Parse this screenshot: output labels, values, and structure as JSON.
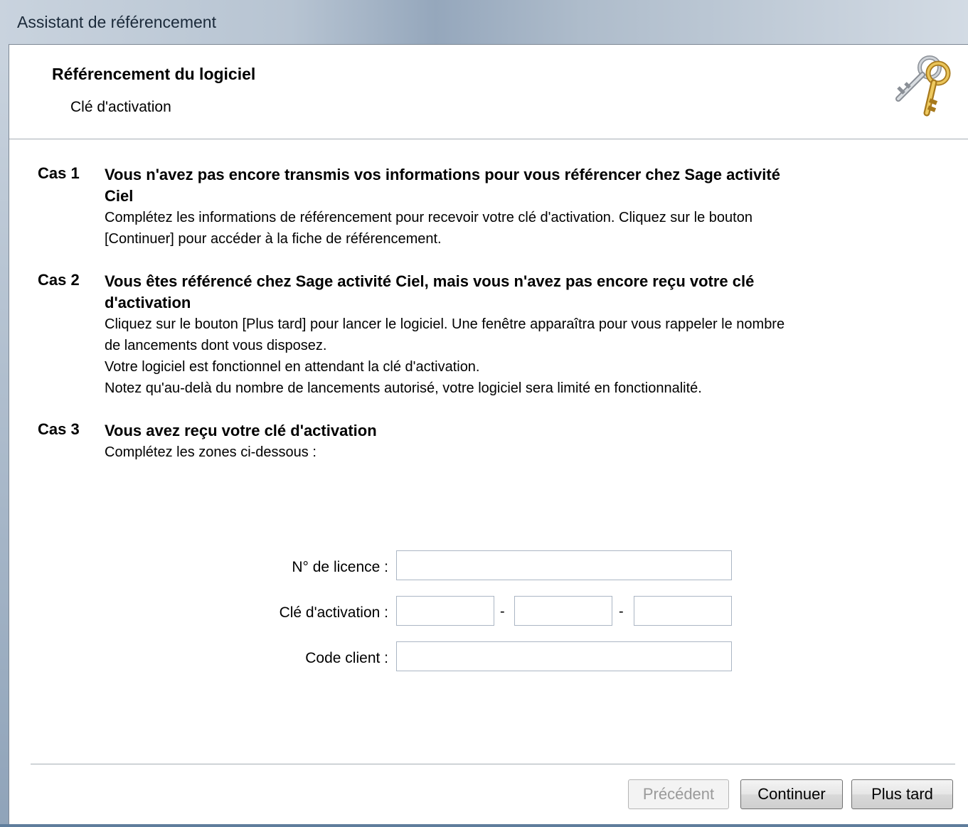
{
  "window": {
    "title": "Assistant de référencement"
  },
  "header": {
    "title": "Référencement du logiciel",
    "subtitle": "Clé d'activation",
    "icon": "keys-icon"
  },
  "cases": [
    {
      "number": "Cas 1",
      "title_lines": [
        "Vous n'avez pas encore transmis vos informations pour vous référencer chez Sage activité",
        "Ciel"
      ],
      "lines": [
        "Complétez les informations de référencement pour recevoir votre clé d'activation. Cliquez sur le bouton",
        "[Continuer] pour accéder à la fiche de référencement."
      ]
    },
    {
      "number": "Cas 2",
      "title_lines": [
        "Vous êtes référencé chez Sage activité Ciel, mais vous n'avez pas encore reçu votre clé",
        "d'activation"
      ],
      "lines": [
        "Cliquez sur le bouton [Plus tard] pour lancer le logiciel. Une fenêtre apparaîtra pour vous rappeler le nombre",
        "de lancements dont vous disposez.",
        "Votre logiciel est fonctionnel en attendant la clé d'activation.",
        "Notez qu'au-delà du nombre de lancements autorisé, votre logiciel sera limité en fonctionnalité."
      ]
    },
    {
      "number": "Cas 3",
      "title_lines": [
        "Vous avez reçu votre clé d'activation"
      ],
      "lines": [
        "Complétez les zones ci-dessous :"
      ]
    }
  ],
  "form": {
    "license_label": "N° de licence :",
    "license_value": "",
    "activation_label": "Clé d'activation :",
    "activation_values": [
      "",
      "",
      ""
    ],
    "separator": "-",
    "client_label": "Code client :",
    "client_value": ""
  },
  "buttons": {
    "previous": "Précédent",
    "continue": "Continuer",
    "later": "Plus tard"
  }
}
